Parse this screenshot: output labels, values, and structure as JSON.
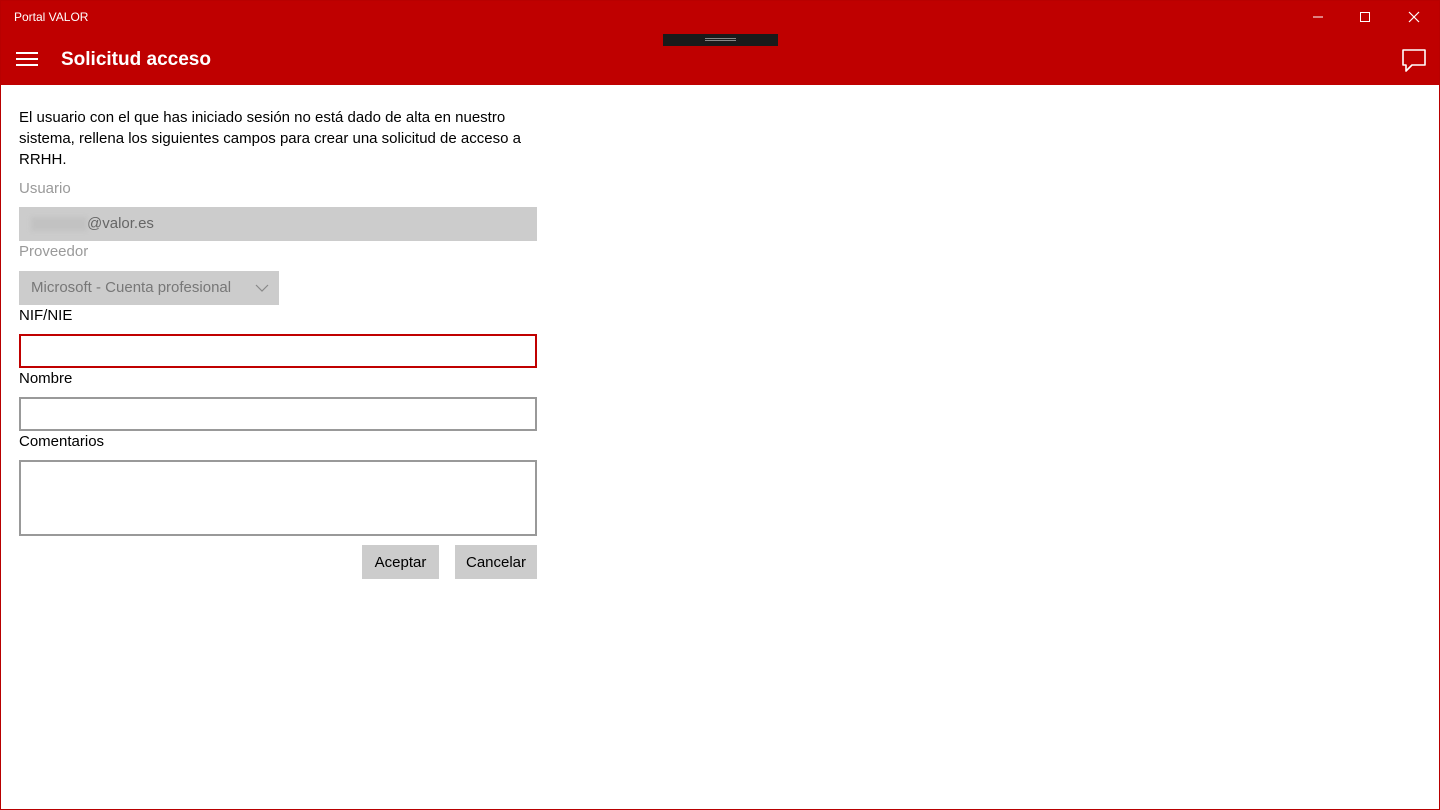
{
  "window": {
    "app_title": "Portal VALOR",
    "minimize_icon": "minimize-icon",
    "maximize_icon": "maximize-icon",
    "close_icon": "close-icon"
  },
  "appbar": {
    "menu_icon": "hamburger-menu-icon",
    "title": "Solicitud acceso",
    "feedback_icon": "chat-bubble-icon",
    "background": "#bf0000"
  },
  "form": {
    "intro": "El usuario con el que has iniciado sesión no está dado de alta en nuestro sistema, rellena los siguientes campos para crear una solicitud de acceso a RRHH.",
    "usuario": {
      "label": "Usuario",
      "value": "@valor.es"
    },
    "proveedor": {
      "label": "Proveedor",
      "selected": "Microsoft - Cuenta profesional"
    },
    "nif": {
      "label": "NIF/NIE",
      "value": ""
    },
    "nombre": {
      "label": "Nombre",
      "value": ""
    },
    "comentarios": {
      "label": "Comentarios",
      "value": ""
    },
    "accept_label": "Aceptar",
    "cancel_label": "Cancelar"
  }
}
